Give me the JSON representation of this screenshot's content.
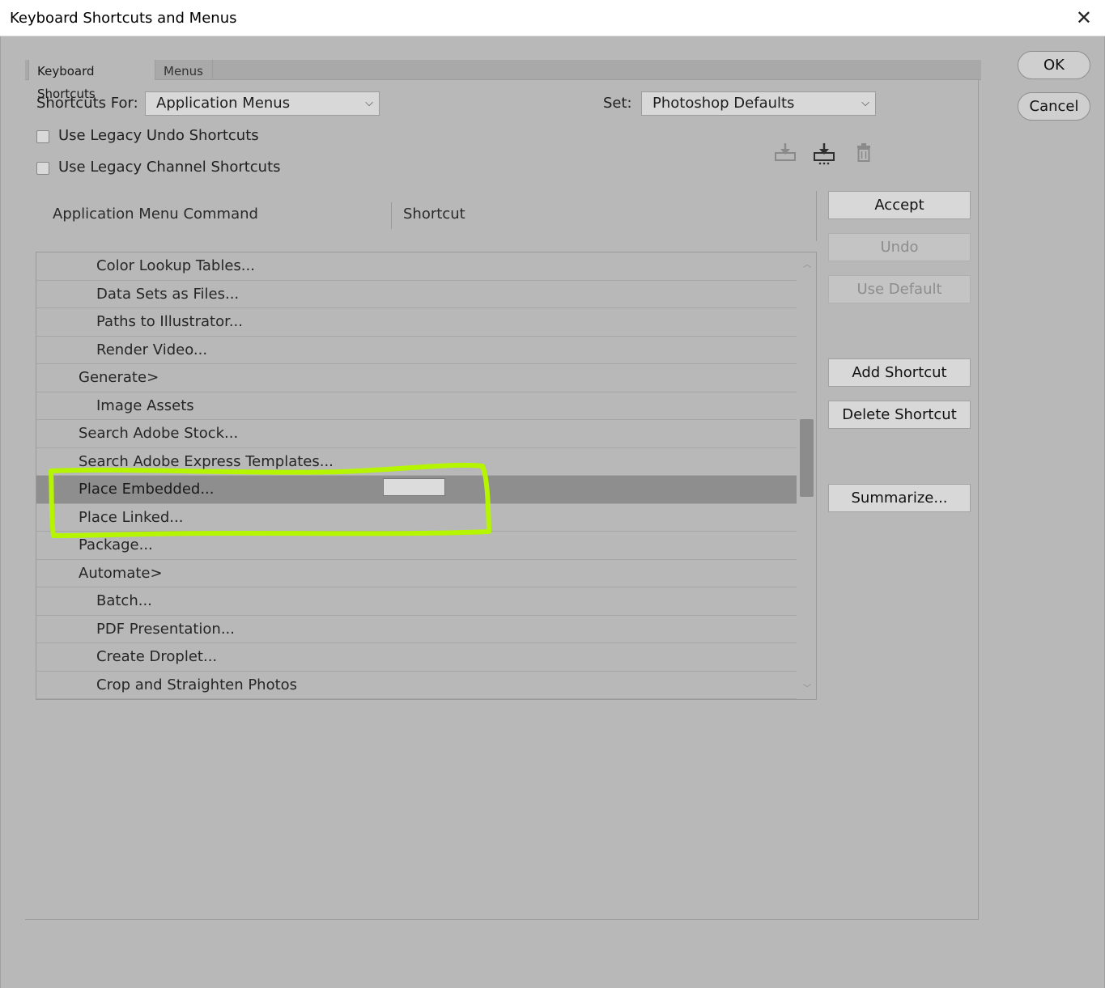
{
  "window": {
    "title": "Keyboard Shortcuts and Menus",
    "close_glyph": "✕"
  },
  "tabs": [
    {
      "label": "Keyboard Shortcuts",
      "active": true
    },
    {
      "label": "Menus",
      "active": false
    }
  ],
  "shortcuts_for": {
    "label": "Shortcuts For:",
    "value": "Application Menus"
  },
  "set": {
    "label": "Set:",
    "value": "Photoshop Defaults"
  },
  "checkboxes": [
    {
      "label": "Use Legacy Undo Shortcuts",
      "checked": false
    },
    {
      "label": "Use Legacy Channel Shortcuts",
      "checked": false
    }
  ],
  "set_icons": [
    "save-set-icon",
    "save-set-as-icon",
    "delete-set-icon"
  ],
  "columns": {
    "command": "Application Menu Command",
    "shortcut": "Shortcut"
  },
  "rows": [
    {
      "label": "Color Lookup Tables...",
      "level": 2
    },
    {
      "label": "Data Sets as Files...",
      "level": 2
    },
    {
      "label": "Paths to Illustrator...",
      "level": 2
    },
    {
      "label": "Render Video...",
      "level": 2
    },
    {
      "label": "Generate>",
      "level": 1
    },
    {
      "label": "Image Assets",
      "level": 2
    },
    {
      "label": "Search Adobe Stock...",
      "level": 1
    },
    {
      "label": "Search Adobe Express Templates...",
      "level": 1
    },
    {
      "label": "Place Embedded...",
      "level": 1,
      "selected": true
    },
    {
      "label": "Place Linked...",
      "level": 1
    },
    {
      "label": "Package...",
      "level": 1
    },
    {
      "label": "Automate>",
      "level": 1
    },
    {
      "label": "Batch...",
      "level": 2
    },
    {
      "label": "PDF Presentation...",
      "level": 2
    },
    {
      "label": "Create Droplet...",
      "level": 2
    },
    {
      "label": "Crop and Straighten Photos",
      "level": 2
    }
  ],
  "side_buttons": {
    "accept": "Accept",
    "undo": "Undo",
    "use_default": "Use Default",
    "add_shortcut": "Add Shortcut",
    "delete_shortcut": "Delete Shortcut",
    "summarize": "Summarize..."
  },
  "dialog_buttons": {
    "ok": "OK",
    "cancel": "Cancel"
  },
  "scroll_arrows": {
    "up": "︿",
    "down": "﹀"
  },
  "select_arrow": "⌵",
  "colors": {
    "highlight_marker": "#b5f500",
    "selected_row": "#8e8e8e",
    "dialog_bg": "#b8b8b8"
  }
}
